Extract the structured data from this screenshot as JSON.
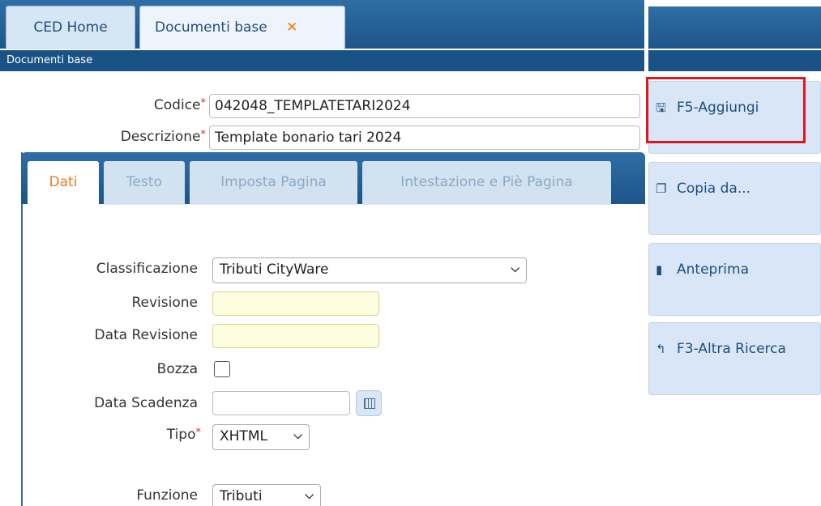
{
  "tabs": {
    "home": "CED Home",
    "documenti": "Documenti base",
    "close_glyph": "✕"
  },
  "subtitle": "Documenti base",
  "form": {
    "codice_label": "Codice",
    "codice_value": "042048_TEMPLATETARI2024",
    "descrizione_label": "Descrizione",
    "descrizione_value": "Template bonario tari 2024",
    "required_mark": "*"
  },
  "inner_tabs": [
    "Dati",
    "Testo",
    "Imposta Pagina",
    "Intestazione e Piè Pagina"
  ],
  "dati": {
    "classificazione_label": "Classificazione",
    "classificazione_value": "Tributi CityWare",
    "revisione_label": "Revisione",
    "data_revisione_label": "Data Revisione",
    "bozza_label": "Bozza",
    "data_scadenza_label": "Data Scadenza",
    "tipo_label": "Tipo",
    "tipo_value": "XHTML",
    "funzione_label": "Funzione",
    "funzione_value": "Tributi"
  },
  "actions": {
    "aggiungi": "F5-Aggiungi",
    "copia": "Copia da...",
    "anteprima": "Anteprima",
    "altra_ricerca": "F3-Altra Ricerca"
  },
  "icons": {
    "aggiungi": "floppy-disk-icon",
    "copia": "copy-icon",
    "anteprima": "file-icon",
    "altra_ricerca": "reply-arrow-icon",
    "calendar": "calendar-icon"
  },
  "colors": {
    "header_blue": "#1d5589",
    "active_tab_text": "#e37b2a",
    "required_red": "#d32f2f",
    "highlight_red": "#e0161e",
    "field_yellow": "#fffde0"
  }
}
